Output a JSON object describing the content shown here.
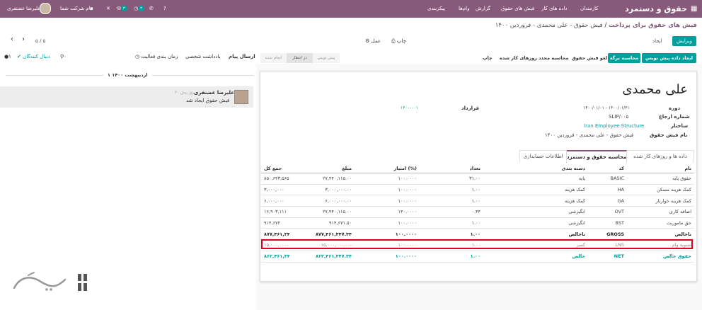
{
  "navbar": {
    "app_title": "حقوق و دستمزد",
    "menu": [
      "کارمندان",
      "داده های کار",
      "فیش های حقوق",
      "گزارش",
      "وام‌ها",
      "پیکربندی"
    ],
    "company": "نام شرکت شما",
    "user": "علیرضا غضنفری",
    "chat_badge": "۳",
    "activity_badge": "۳",
    "colors": {
      "bar": "#875a7b",
      "badge": "#00a09d"
    }
  },
  "breadcrumb": {
    "parent": "فیش های حقوق برای پرداخت",
    "separator": "/",
    "current": "فیش حقوق - علی محمدی - فروردین ۱۴۰۰"
  },
  "actions": {
    "edit": "ویرایش",
    "create": "ایجاد",
    "print": "چاپ",
    "action": "عمل",
    "pager": "۵ / ۵"
  },
  "statusbar": {
    "buttons": [
      "ایجاد داده پیش نویس",
      "محاسبه برگه",
      "لغو فیش حقوق",
      "محاسبه مجدد روزهای کار شده",
      "چاپ"
    ],
    "stages": [
      "پیش نویس",
      "در انتظار",
      "انجام شده"
    ],
    "active_stage": "در انتظار"
  },
  "form": {
    "employee_name": "علی محمدی",
    "period_label": "دوره",
    "period_value": "۱۴۰۰/۰۱/۰۱ - ۱۴۰۰/۰۱/۳۱",
    "reference_label": "شماره ارجاع",
    "reference_value": "SLIP/۰۰۵",
    "structure_label": "ساختار",
    "structure_value": "Iran Employee Structure",
    "payslip_name_label": "نام فیش حقوق",
    "payslip_name_value": "فیش حقوق - علی محمدی - فروردین ۱۴۰۰",
    "contract_label": "قرارداد",
    "contract_value": "۱۴۰۰-۰۰۱"
  },
  "tabs": [
    "داده ها و روزهای کار شده",
    "محاسبه حقوق و دستمزد",
    "اطلاعات حسابداری"
  ],
  "table": {
    "headers": [
      "نام",
      "کد",
      "دسته بندی",
      "تعداد",
      "امتیاز (%)",
      "مبلغ",
      "جمع کل"
    ],
    "rows": [
      [
        "حقوق پایه",
        "BASIC",
        "پایه",
        "۳۱.۰۰",
        "۱۰۰.۰۰۰۰",
        "۲۷,۴۴۰,۱۱۵.۰۰",
        "۸۵۰,۶۴۳,۵۶۵"
      ],
      [
        "کمک هزینه مسکن",
        "HA",
        "کمک هزینه",
        "۱.۰۰",
        "۱۰۰.۰۰۰۰",
        "۳,۰۰۰,۰۰۰.۰۰",
        "۳,۰۰۰,۰۰۰"
      ],
      [
        "کمک هزینه خواربار",
        "GA",
        "کمک هزینه",
        "۱.۰۰",
        "۱۰۰.۰۰۰۰",
        "۶,۰۰۰,۰۰۰.۰۰",
        "۶,۰۰۰,۰۰۰"
      ],
      [
        "اضافه کاری",
        "OVT",
        "انگیزشی",
        "۰.۴۴",
        "۱۴۰.۰۰۰۰",
        "۲۷,۴۴۰,۱۱۵.۰۰",
        "۱۶,۹۰۳,۱۱۱"
      ],
      [
        "حق ماموریت",
        "BST",
        "انگیزشی",
        "۱.۰۰",
        "۱۰۰.۰۰۰۰",
        "۹۱۴,۶۷۱.۵۰",
        "۹۱۴,۶۷۲"
      ],
      [
        "ناخالص",
        "GROSS",
        "ناخالص",
        "۱.۰۰",
        "۱۰۰.۰۰۰۰",
        "۸۷۷,۴۶۱,۳۴۷.۳۴",
        "۸۷۷,۴۶۱,۳۴۷"
      ],
      [
        "تسویه وام",
        "LNS",
        "کسر",
        "۱.۰۰",
        "۱۰۰.۰۰۰۰",
        "۱۵,۰۰۰,۰۰۰.۰۰-",
        "۱۵,۰۰۰,۰۰۰-"
      ],
      [
        "حقوق خالص",
        "NET",
        "خالص",
        "۱.۰۰",
        "۱۰۰.۰۰۰۰",
        "۸۶۲,۴۶۱,۳۴۷.۳۴",
        "۸۶۲,۴۶۱,۳۴۷"
      ]
    ]
  },
  "chatter": {
    "send_message": "ارسال پیام",
    "log_note": "یادداشت شخصی",
    "schedule_activity": "زمان بندی فعالیت",
    "attachments": "۰",
    "follow": "دنبال کنندگان",
    "followers": "۱",
    "date_separator": "۱ اردیبهشت ۱۴۰۰",
    "author": "علیرضا غضنفری",
    "time": "۲۰ روز پیش",
    "body": "فیش حقوق ایجاد شد"
  }
}
